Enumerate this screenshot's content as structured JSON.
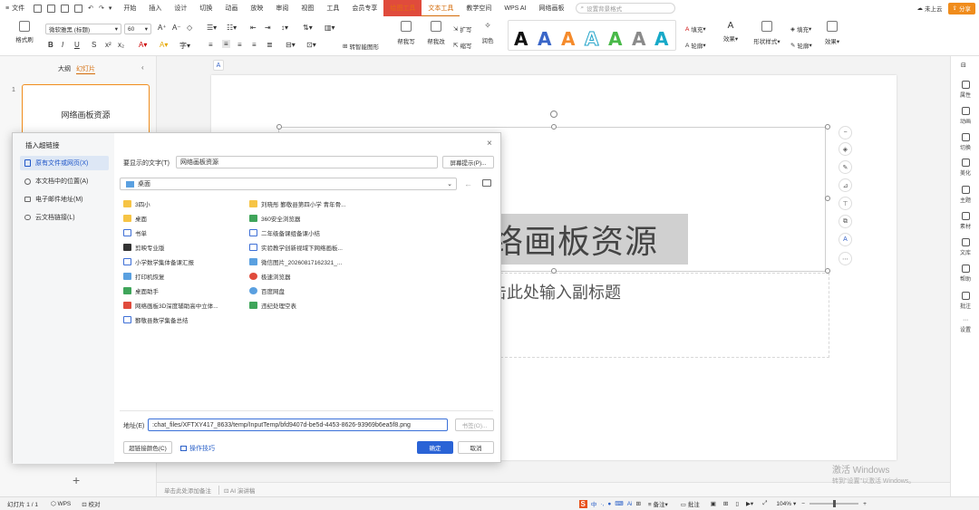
{
  "menubar": {
    "file": "文件",
    "tabs": [
      "开始",
      "插入",
      "设计",
      "切换",
      "动画",
      "放映",
      "审阅",
      "视图",
      "工具",
      "会员专享",
      "绘图工具",
      "文本工具",
      "教学空间",
      "WPS AI",
      "网络画板"
    ],
    "search_placeholder": "设置背景格式",
    "cloud": "未上云",
    "share": "分享"
  },
  "ribbon": {
    "format_painter": "格式刷",
    "font_name": "微软雅黑 (标题)",
    "font_size": "60",
    "convert_shape": "转智能图形",
    "help_write": "帮我写",
    "help_edit": "帮我改",
    "expand": "扩写",
    "shrink": "缩写",
    "polish": "润色",
    "fill": "填充",
    "outline": "轮廓",
    "effect": "效果",
    "shape_style": "形状样式",
    "fill2": "填充",
    "outline2": "轮廓",
    "effect2": "效果"
  },
  "leftpanel": {
    "tab_outline": "大纲",
    "tab_slides": "幻灯片",
    "slide_number": "1",
    "thumb_title": "网络画板资源"
  },
  "slide": {
    "title": "络画板资源",
    "subtitle": "击此处输入副标题",
    "notes": "单击此处添加备注",
    "ai_speech": "AI 演讲稿"
  },
  "dialog": {
    "title": "插入超链接",
    "side": [
      "原有文件或网页(X)",
      "本文档中的位置(A)",
      "电子邮件地址(M)",
      "云文档链接(L)"
    ],
    "display_label": "要显示的文字(T)",
    "display_value": "网络画板资源",
    "screen_tip": "屏幕提示(P)...",
    "location": "桌面",
    "files_col1": [
      "3四小",
      "桌面",
      "书单",
      "剪映专业版",
      "小学数学集体备课汇报",
      "打印机恢复",
      "桌面助手",
      "网络画板3D深度辅助高中立体...",
      "鄞敬县数学集备总结"
    ],
    "files_col2": [
      "刘晓彤 鄞敬县第四小学 青年骨...",
      "360安全浏览器",
      "二年级备课组备课小结",
      "实验教学创新视域下网络画板...",
      "微信图片_20260817162321_...",
      "极速浏览器",
      "百度网盘",
      "违纪处理空表"
    ],
    "address_label": "地址(E)",
    "address_value": ":chat_files/XFTXY417_8633/temp/InputTemp/bfd9407d-be5d-4453-8626-93969b6ea5f8.png",
    "bookmark": "书签(O)...",
    "link_color": "超链接颜色(C)",
    "tips": "操作技巧",
    "ok": "确定",
    "cancel": "取消"
  },
  "statusbar": {
    "slide_info": "幻灯片 1 / 1",
    "theme": "WPS",
    "proof": "校对",
    "notes": "备注",
    "comment": "批注",
    "zoom": "104%"
  },
  "rightbar": [
    "属性",
    "动画",
    "切换",
    "美化",
    "主题",
    "素材",
    "文库",
    "帮助",
    "批注",
    "设置"
  ],
  "watermark": {
    "line1": "激活 Windows",
    "line2": "转到\"设置\"以激活 Windows。"
  }
}
